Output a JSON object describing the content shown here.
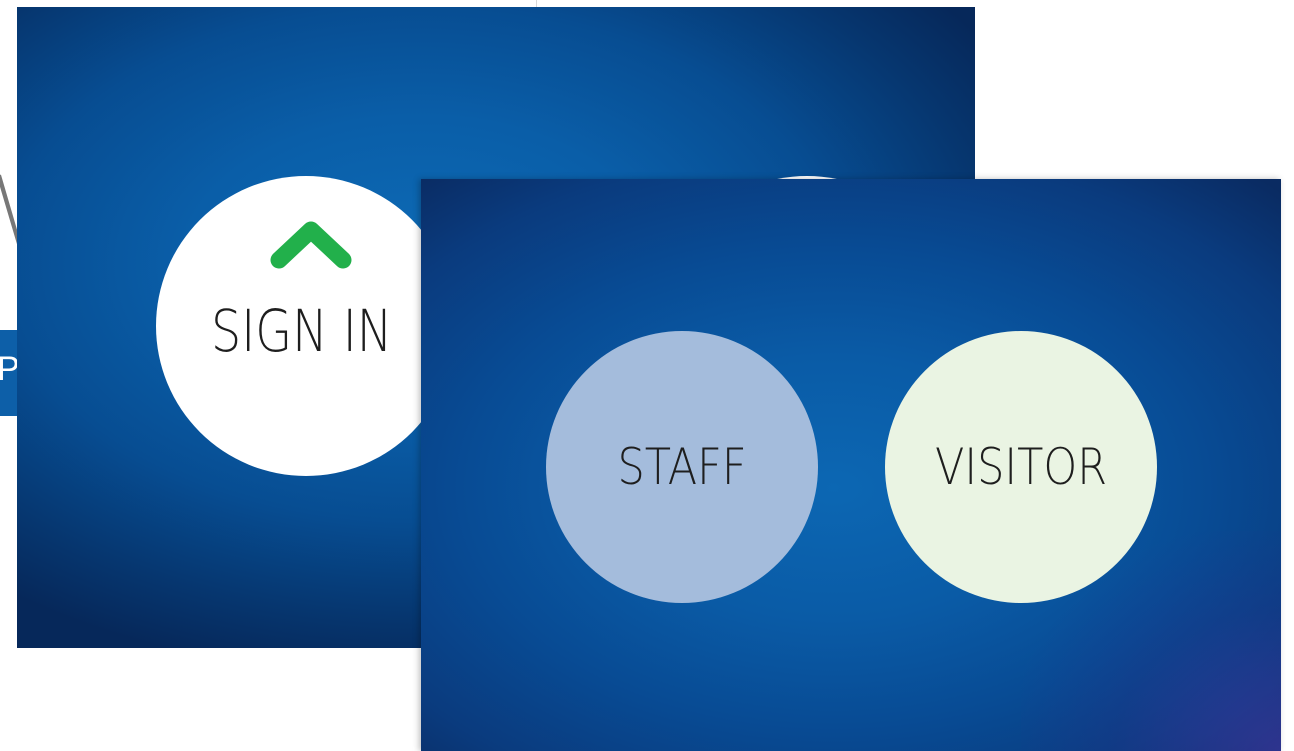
{
  "background_page": {
    "heading_fragment": "V",
    "button_fragment_label": "P"
  },
  "sign_in_screen": {
    "sign_in_label": "SIGN IN",
    "sign_in_icon": "chevron-up-icon",
    "icon_color": "#22b04b"
  },
  "type_select_screen": {
    "staff_label": "STAFF",
    "visitor_label": "VISITOR",
    "staff_color": "#a4bcdc",
    "visitor_color": "#eaf4e3"
  },
  "colors": {
    "screen_blue": "#0a5ba6",
    "screen_dark": "#06285a"
  }
}
